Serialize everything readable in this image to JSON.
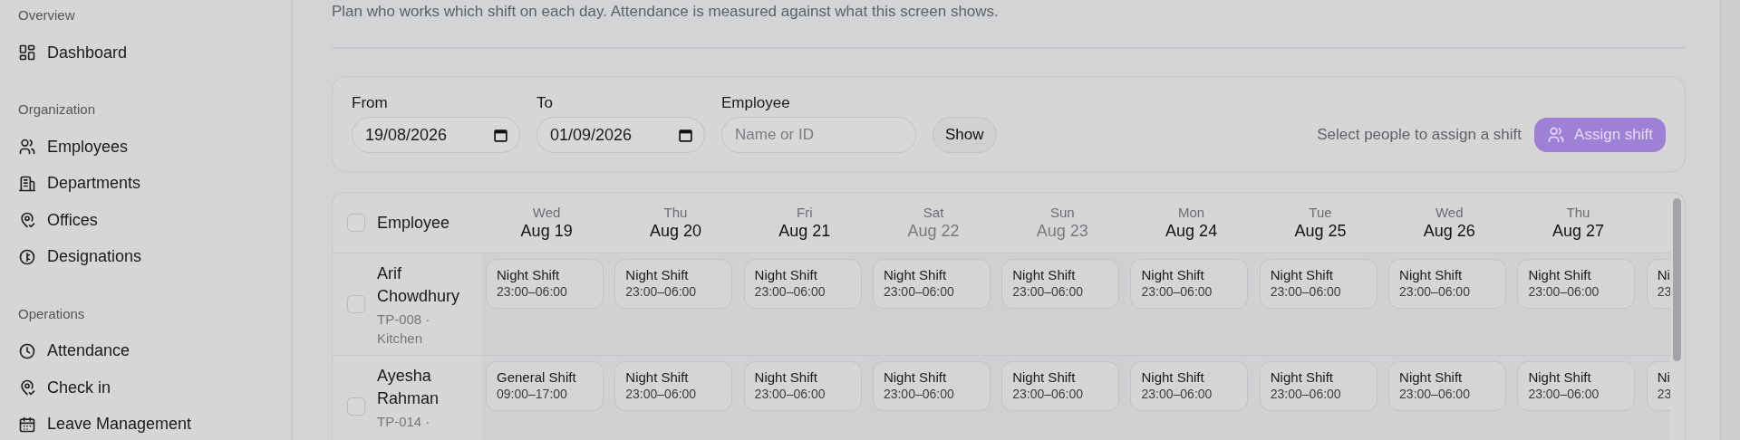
{
  "sidebar": {
    "sections": [
      {
        "title": "Overview",
        "items": [
          {
            "label": "Dashboard"
          }
        ]
      },
      {
        "title": "Organization",
        "items": [
          {
            "label": "Employees"
          },
          {
            "label": "Departments"
          },
          {
            "label": "Offices"
          },
          {
            "label": "Designations"
          }
        ]
      },
      {
        "title": "Operations",
        "items": [
          {
            "label": "Attendance"
          },
          {
            "label": "Check in"
          },
          {
            "label": "Leave Management"
          }
        ]
      }
    ]
  },
  "description": "Plan who works which shift on each day. Attendance is measured against what this screen shows.",
  "filters": {
    "from": {
      "label": "From",
      "value": "19/08/2026"
    },
    "to": {
      "label": "To",
      "value": "01/09/2026"
    },
    "employee": {
      "label": "Employee",
      "placeholder": "Name or ID"
    },
    "show_button": "Show",
    "hint": "Select people to assign a shift",
    "assign_button": {
      "label": "Assign shift",
      "disabled": true
    }
  },
  "table": {
    "header_label": "Employee",
    "header_checked": false,
    "days": [
      {
        "weekday": "Wed",
        "date": "Aug 19",
        "weekend": false
      },
      {
        "weekday": "Thu",
        "date": "Aug 20",
        "weekend": false
      },
      {
        "weekday": "Fri",
        "date": "Aug 21",
        "weekend": false
      },
      {
        "weekday": "Sat",
        "date": "Aug 22",
        "weekend": true
      },
      {
        "weekday": "Sun",
        "date": "Aug 23",
        "weekend": true
      },
      {
        "weekday": "Mon",
        "date": "Aug 24",
        "weekend": false
      },
      {
        "weekday": "Tue",
        "date": "Aug 25",
        "weekend": false
      },
      {
        "weekday": "Wed",
        "date": "Aug 26",
        "weekend": false
      },
      {
        "weekday": "Thu",
        "date": "Aug 27",
        "weekend": false
      }
    ],
    "rows": [
      {
        "name": "Arif Chowdhury",
        "meta": "TP-008 · Kitchen",
        "checked": false,
        "shifts": [
          {
            "name": "Night Shift",
            "time": "23:00–06:00"
          },
          {
            "name": "Night Shift",
            "time": "23:00–06:00"
          },
          {
            "name": "Night Shift",
            "time": "23:00–06:00"
          },
          {
            "name": "Night Shift",
            "time": "23:00–06:00"
          },
          {
            "name": "Night Shift",
            "time": "23:00–06:00"
          },
          {
            "name": "Night Shift",
            "time": "23:00–06:00"
          },
          {
            "name": "Night Shift",
            "time": "23:00–06:00"
          },
          {
            "name": "Night Shift",
            "time": "23:00–06:00"
          },
          {
            "name": "Night Shift",
            "time": "23:00–06:00"
          },
          {
            "name": "Ni",
            "time": "23"
          }
        ]
      },
      {
        "name": "Ayesha Rahman",
        "meta": "TP-014 ·",
        "checked": false,
        "shifts": [
          {
            "name": "General Shift",
            "time": "09:00–17:00"
          },
          {
            "name": "Night Shift",
            "time": "23:00–06:00"
          },
          {
            "name": "Night Shift",
            "time": "23:00–06:00"
          },
          {
            "name": "Night Shift",
            "time": "23:00–06:00"
          },
          {
            "name": "Night Shift",
            "time": "23:00–06:00"
          },
          {
            "name": "Night Shift",
            "time": "23:00–06:00"
          },
          {
            "name": "Night Shift",
            "time": "23:00–06:00"
          },
          {
            "name": "Night Shift",
            "time": "23:00–06:00"
          },
          {
            "name": "Night Shift",
            "time": "23:00–06:00"
          },
          {
            "name": "Ni",
            "time": "23"
          }
        ]
      }
    ]
  }
}
